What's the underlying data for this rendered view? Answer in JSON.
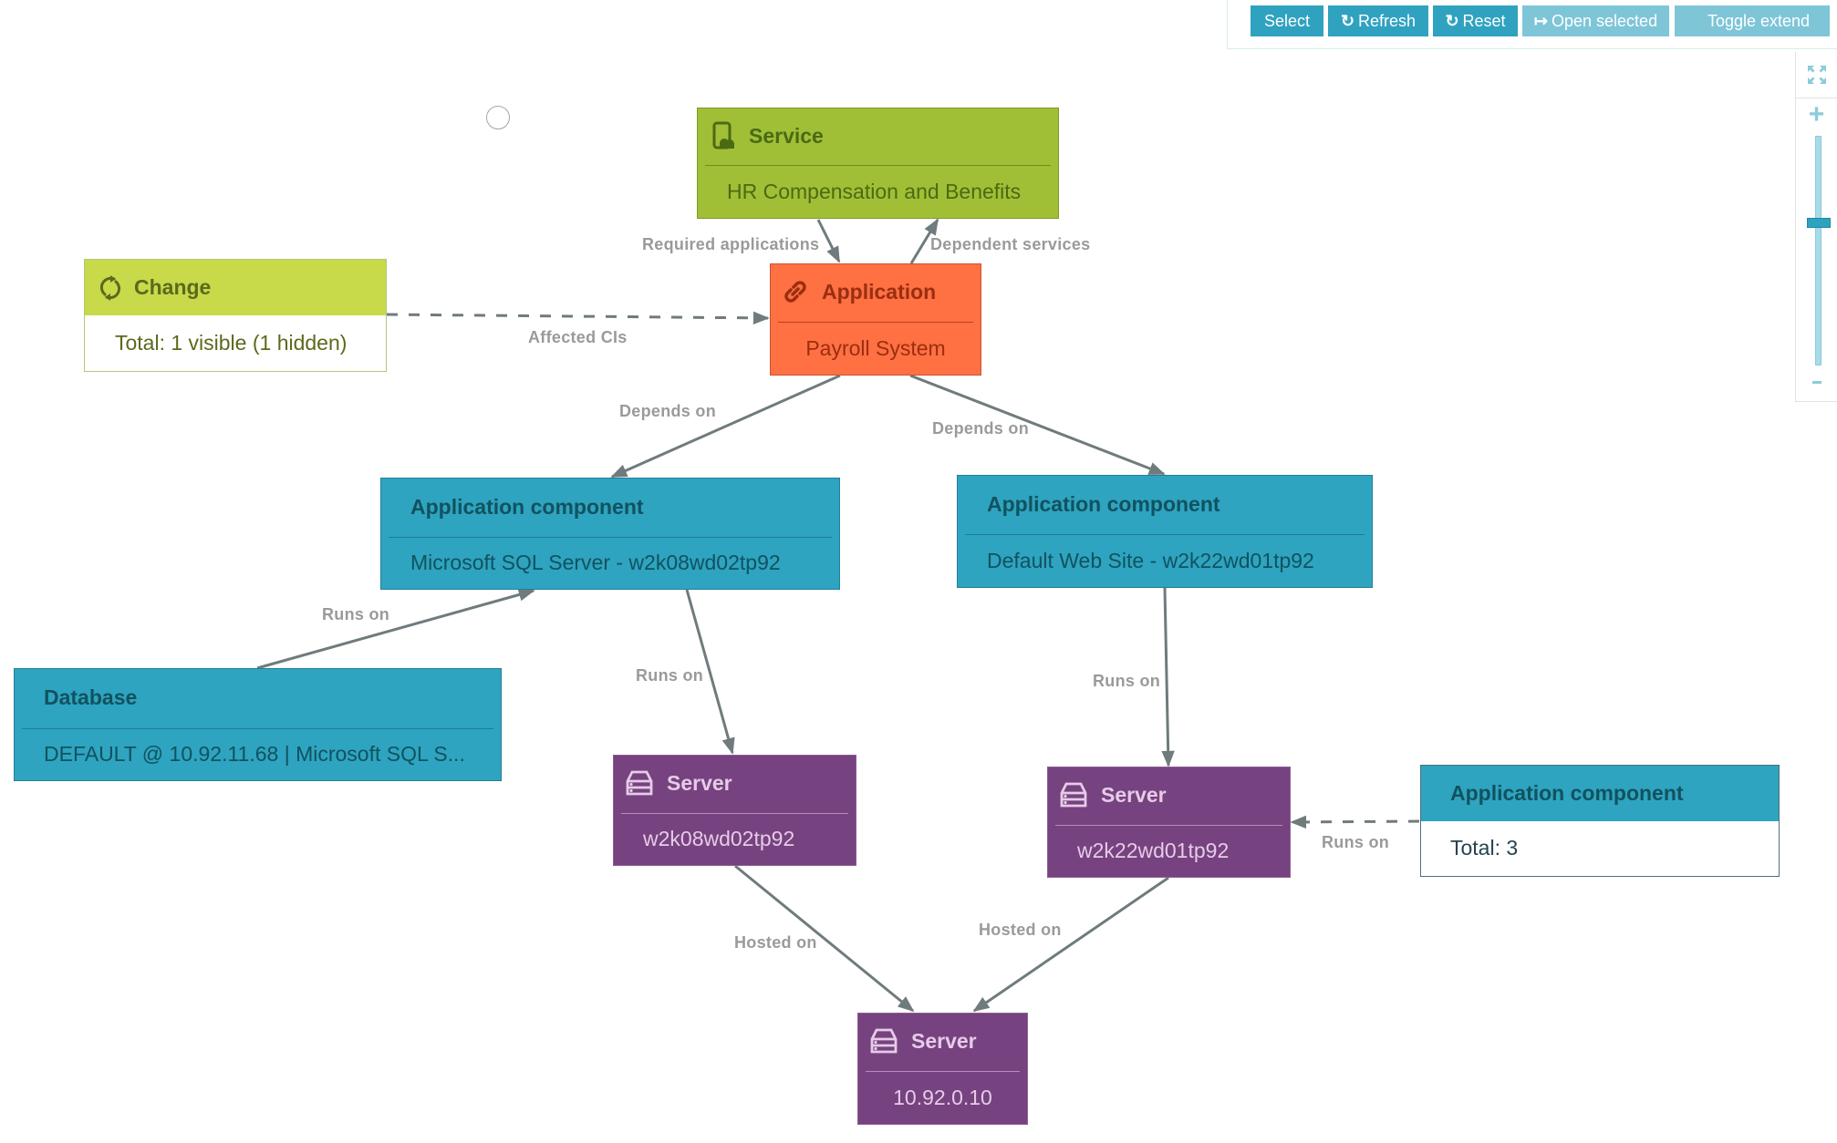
{
  "toolbar": {
    "buttons": [
      {
        "label": "Select",
        "icon": "",
        "state": "active"
      },
      {
        "label": "Refresh",
        "icon": "refresh-icon",
        "state": "active"
      },
      {
        "label": "Reset",
        "icon": "refresh-icon",
        "state": "active"
      },
      {
        "label": "Open selected",
        "icon": "sign-in-icon",
        "state": "disabled"
      },
      {
        "label": "Toggle extend",
        "icon": "",
        "state": "disabled"
      }
    ]
  },
  "zoom_control": {
    "fit_icon": "expand-icon",
    "zoom_in_label": "+",
    "zoom_out_label": "-",
    "level_fraction_from_top": 0.38
  },
  "colors": {
    "service": "#a1bf36",
    "application": "#ff7043",
    "application_component": "#2ea4c0",
    "server": "#76427f",
    "change": "#c8d94a",
    "edge": "#6f7b7d",
    "button_active": "#2fa2c0",
    "button_disabled": "#7ec5d8"
  },
  "nodes": {
    "service": {
      "type": "Service",
      "name": "HR Compensation and Benefits",
      "icon": "service-cloud-icon"
    },
    "application": {
      "type": "Application",
      "name": "Payroll System",
      "icon": "link-icon"
    },
    "change": {
      "type": "Change",
      "name": "Total: 1 visible (1 hidden)",
      "icon": "sync-icon"
    },
    "appcomp_sql": {
      "type": "Application component",
      "name": "Microsoft SQL Server - w2k08wd02tp92"
    },
    "appcomp_web": {
      "type": "Application component",
      "name": "Default Web Site - w2k22wd01tp92"
    },
    "database": {
      "type": "Database",
      "name": "DEFAULT @ 10.92.11.68 | Microsoft SQL S..."
    },
    "server1": {
      "type": "Server",
      "name": "w2k08wd02tp92",
      "icon": "server-icon"
    },
    "server2": {
      "type": "Server",
      "name": "w2k22wd01tp92",
      "icon": "server-icon"
    },
    "appcomp_group": {
      "type": "Application component",
      "name": "Total: 3"
    },
    "server3": {
      "type": "Server",
      "name": "10.92.0.10",
      "icon": "server-icon"
    }
  },
  "edges": [
    {
      "from": "service",
      "to": "application",
      "label": "Required applications",
      "style": "solid"
    },
    {
      "from": "application",
      "to": "service",
      "label": "Dependent services",
      "style": "solid"
    },
    {
      "from": "change",
      "to": "application",
      "label": "Affected CIs",
      "style": "dashed"
    },
    {
      "from": "application",
      "to": "appcomp_sql",
      "label": "Depends on",
      "style": "solid"
    },
    {
      "from": "application",
      "to": "appcomp_web",
      "label": "Depends on",
      "style": "solid"
    },
    {
      "from": "database",
      "to": "appcomp_sql",
      "label": "Runs on",
      "style": "solid"
    },
    {
      "from": "appcomp_sql",
      "to": "server1",
      "label": "Runs on",
      "style": "solid"
    },
    {
      "from": "appcomp_web",
      "to": "server2",
      "label": "Runs on",
      "style": "solid"
    },
    {
      "from": "appcomp_group",
      "to": "server2",
      "label": "Runs on",
      "style": "dashed"
    },
    {
      "from": "server1",
      "to": "server3",
      "label": "Hosted on",
      "style": "solid"
    },
    {
      "from": "server2",
      "to": "server3",
      "label": "Hosted on",
      "style": "solid"
    }
  ]
}
